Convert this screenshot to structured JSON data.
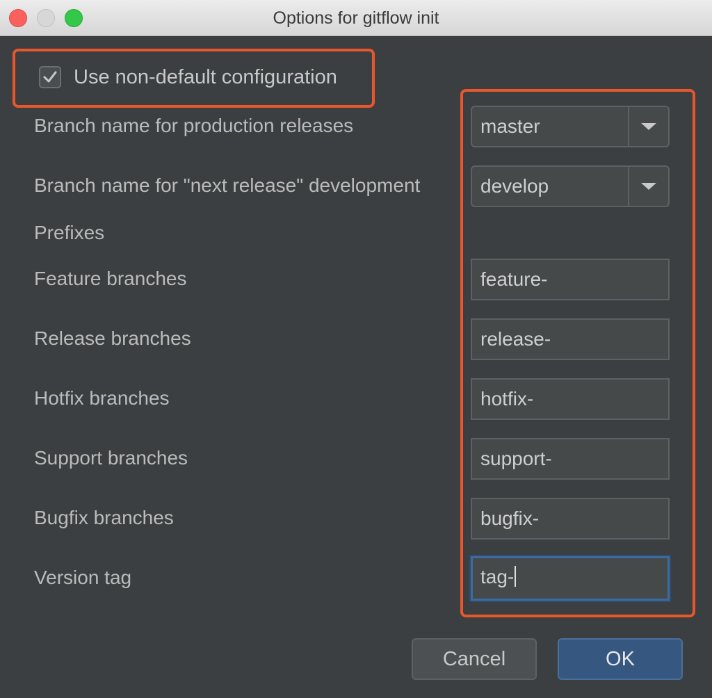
{
  "window": {
    "title": "Options for gitflow init"
  },
  "config_toggle": {
    "label": "Use non-default configuration",
    "checked": true
  },
  "branches": {
    "production": {
      "label": "Branch name for production releases",
      "value": "master"
    },
    "development": {
      "label": "Branch name for \"next release\" development",
      "value": "develop"
    }
  },
  "prefixes": {
    "heading": "Prefixes",
    "feature": {
      "label": "Feature branches",
      "value": "feature-"
    },
    "release": {
      "label": "Release branches",
      "value": "release-"
    },
    "hotfix": {
      "label": "Hotfix branches",
      "value": "hotfix-"
    },
    "support": {
      "label": "Support branches",
      "value": "support-"
    },
    "bugfix": {
      "label": "Bugfix branches",
      "value": "bugfix-"
    },
    "version_tag": {
      "label": "Version tag",
      "value": "tag-"
    }
  },
  "buttons": {
    "cancel": "Cancel",
    "ok": "OK"
  },
  "colors": {
    "highlight": "#e8572c",
    "accent": "#365880",
    "background": "#3c3f41"
  }
}
